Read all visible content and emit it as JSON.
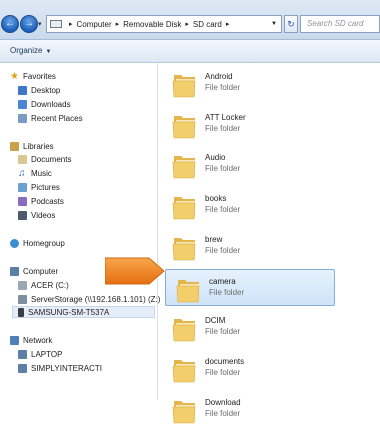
{
  "address_bar": {
    "breadcrumb": [
      "Computer",
      "Removable Disk",
      "SD card"
    ],
    "search_placeholder": "Search SD card"
  },
  "command_bar": {
    "organize_label": "Organize"
  },
  "nav_pane": {
    "favorites_header": "Favorites",
    "favorites": [
      "Desktop",
      "Downloads",
      "Recent Places"
    ],
    "libraries_header": "Libraries",
    "libraries": [
      "Documents",
      "Music",
      "Pictures",
      "Podcasts",
      "Videos"
    ],
    "homegroup": "Homegroup",
    "computer_header": "Computer",
    "computer_items": [
      "ACER (C:)",
      "ServerStorage (\\\\192.168.1.101) (Z:)",
      "SAMSUNG-SM-T537A"
    ],
    "network_header": "Network",
    "network_items": [
      "LAPTOP",
      "SIMPLYINTERACTI"
    ]
  },
  "folders": [
    {
      "name": "Android",
      "type": "File folder"
    },
    {
      "name": "ATT Locker",
      "type": "File folder"
    },
    {
      "name": "Audio",
      "type": "File folder"
    },
    {
      "name": "books",
      "type": "File folder"
    },
    {
      "name": "brew",
      "type": "File folder"
    },
    {
      "name": "camera",
      "type": "File folder"
    },
    {
      "name": "DCIM",
      "type": "File folder"
    },
    {
      "name": "documents",
      "type": "File folder"
    },
    {
      "name": "Download",
      "type": "File folder"
    }
  ],
  "selected_folder": "camera",
  "colors": {
    "callout_arrow": "#f07d1a",
    "selection": "#cfe4f8",
    "folder": "#f2cf6b"
  }
}
